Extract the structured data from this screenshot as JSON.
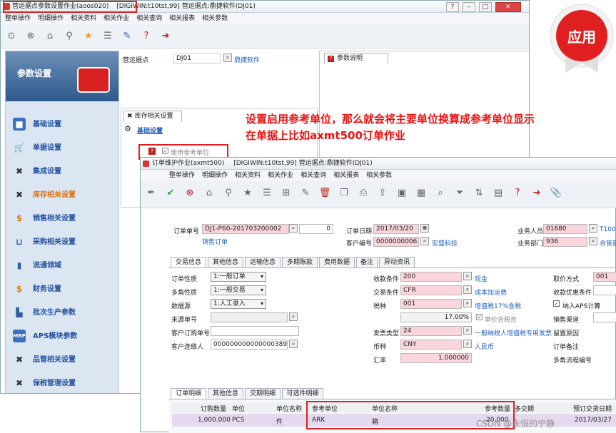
{
  "win1": {
    "title": "营运据点参数设置作业(aoos020)",
    "title_rest": "[DIGIWIN:t10tst,99]    营运据点:鼎捷软件(DJ01)",
    "menu": [
      "整单操作",
      "明细操作",
      "相关资料",
      "相关作业",
      "相关查询",
      "相关报表",
      "相关参数"
    ],
    "site_label": "营运据点",
    "site_code": "DJ01",
    "site_name": "鼎捷软件",
    "param_tab": "参数说明",
    "section_tab": "库存相关设置",
    "basic_link": "基础设置",
    "checkbox_label": "使用参考单位",
    "sidebar_title": "参数设置",
    "sidebar_items": [
      "基础设置",
      "单据设置",
      "集成设置",
      "库存相关设置",
      "销售相关设置",
      "采购相关设置",
      "流通领域",
      "财务设置",
      "批次生产参数",
      "APS模块参数",
      "品管相关设置",
      "保税管理设置"
    ]
  },
  "annotation": {
    "line1": "设置启用参考单位，那么就会将主要单位换算成参考单位显示",
    "line2": "在单据上比如axmt500订单作业"
  },
  "badge": {
    "text": "应用"
  },
  "win2": {
    "title": "订单维护作业(axmt500)",
    "title_rest": "[DIGIWIN:t10tst,99]    营运据点:鼎捷软件(DJ01)",
    "menu": [
      "整单操作",
      "明细操作",
      "相关资料",
      "相关作业",
      "相关查询",
      "相关报表",
      "相关参数"
    ],
    "order_no_label": "订单单号",
    "order_no": "DJ1-P60-201703200002",
    "order_seq": "0",
    "order_type": "销售订单",
    "order_date_label": "订单日期",
    "order_date": "2017/03/20",
    "cust_no_label": "客户编号",
    "cust_no": "0000000006",
    "cust_name": "宏盛科技",
    "salesman_label": "业务人员",
    "salesman": "01680",
    "salesman_name": "T100",
    "dept_label": "业务部门",
    "dept": "936",
    "dept_name": "合管部",
    "tabs": [
      "交易信息",
      "其他信息",
      "运输信息",
      "多期账款",
      "费用数据",
      "备注",
      "异动资讯"
    ],
    "nature_label": "订单性质",
    "nature": "1:一般订单",
    "multi_label": "多角性质",
    "multi": "1:一般交易",
    "source_label": "数据源",
    "source": "1:人工录入",
    "source_no_label": "来源单号",
    "cust_po_label": "客户订购单号",
    "contact_label": "客户连络人",
    "contact": "0000000000000003893",
    "pay_label": "收款条件",
    "pay": "200",
    "pay_name": "现金",
    "trade_label": "交易条件",
    "trade": "CFR",
    "trade_name": "成本加运费",
    "tax_label": "税种",
    "tax": "001",
    "tax_name": "增值税17%含税",
    "tax_rate": "17.00%",
    "tax_incl_label": "单价含税否",
    "invoice_label": "发票类型",
    "invoice": "24",
    "invoice_name": "一般纳税人增值税专用发票",
    "currency_label": "币种",
    "currency": "CNY",
    "currency_name": "人民币",
    "rate_label": "汇率",
    "rate": "1.000000",
    "take_label": "取价方式",
    "take": "001",
    "discount_label": "收款优惠条件",
    "aps_label": "纳入APS计算",
    "channel_label": "销售渠道",
    "reserve_label": "留置原因",
    "order_note_label": "订单备注",
    "multi_flow_label": "多角流程编号",
    "detail_tabs": [
      "订单明细",
      "其他信息",
      "交期明细",
      "可选件明细"
    ],
    "detail_cols": [
      "订购数量",
      "单位",
      "单位名称",
      "参考单位",
      "单位名称",
      "参考数量",
      "多交期",
      "预订交货日期"
    ],
    "detail_row": [
      "1,000.000",
      "PCS",
      "件",
      "ARK",
      "箱",
      "20.000",
      "",
      "2017/03/27"
    ],
    "watermark": "CSDN @永恒的宁静"
  }
}
